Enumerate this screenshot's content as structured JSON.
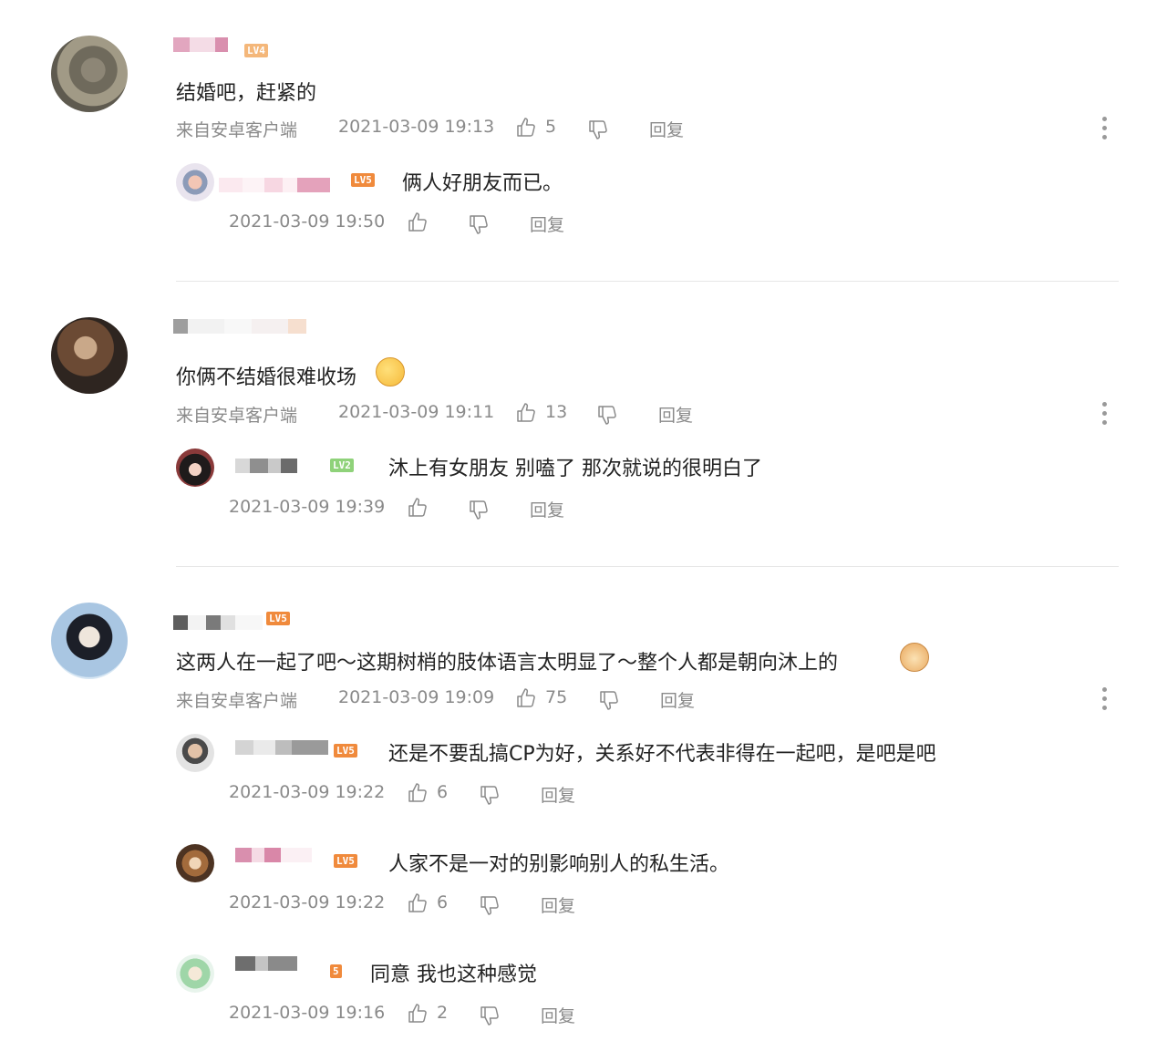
{
  "comments": [
    {
      "text": "结婚吧，赶紧的",
      "badge": "LV4",
      "source": "来自安卓客户端",
      "time": "2021-03-09 19:13",
      "likes": "5",
      "reply": "回复",
      "replies": [
        {
          "badge": "LV5",
          "text": "俩人好朋友而已。",
          "time": "2021-03-09 19:50",
          "likes": "",
          "reply": "回复"
        }
      ]
    },
    {
      "text": "你俩不结婚很难收场",
      "source": "来自安卓客户端",
      "time": "2021-03-09 19:11",
      "likes": "13",
      "reply": "回复",
      "replies": [
        {
          "badge": "LV2",
          "text": "沐上有女朋友 别嗑了 那次就说的很明白了",
          "time": "2021-03-09 19:39",
          "likes": "",
          "reply": "回复"
        }
      ]
    },
    {
      "text": "这两人在一起了吧～这期树梢的肢体语言太明显了～整个人都是朝向沐上的",
      "badge": "LV5",
      "source": "来自安卓客户端",
      "time": "2021-03-09 19:09",
      "likes": "75",
      "reply": "回复",
      "replies": [
        {
          "badge": "LV5",
          "text": "还是不要乱搞CP为好，关系好不代表非得在一起吧，是吧是吧",
          "time": "2021-03-09 19:22",
          "likes": "6",
          "reply": "回复"
        },
        {
          "badge": "LV5",
          "text": "人家不是一对的别影响别人的私生活。",
          "time": "2021-03-09 19:22",
          "likes": "6",
          "reply": "回复"
        },
        {
          "badge": "5",
          "text": "同意 我也这种感觉",
          "time": "2021-03-09 19:16",
          "likes": "2",
          "reply": "回复"
        }
      ]
    }
  ],
  "colors": {
    "badge_orange": "#f08a3c",
    "badge_green": "#8fd27a",
    "meta_gray": "#8a8a8a"
  },
  "icons": [
    "thumbs-up-icon",
    "thumbs-down-icon",
    "more-vertical-icon"
  ]
}
